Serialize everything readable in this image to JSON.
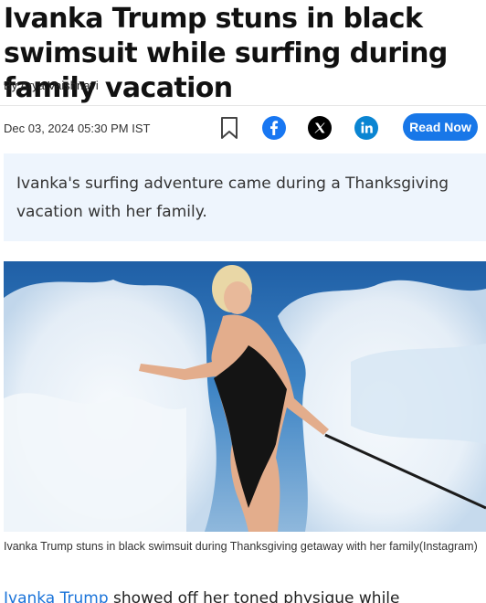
{
  "article": {
    "headline": "Ivanka Trump stuns in black swimsuit while surfing during family vacation",
    "byline": "By Arya Vaishnavi",
    "date": "Dec 03, 2024 05:30 PM IST",
    "read_now_label": "Read Now",
    "summary": "Ivanka's surfing adventure came during a Thanksgiving vacation with her family.",
    "image_caption": "Ivanka Trump stuns in black swimsuit during Thanksgiving getaway with her family(Instagram)",
    "body_link": "Ivanka Trump",
    "body_text": " showed off her toned physique while"
  },
  "share": {
    "bookmark_icon": "bookmark-icon",
    "facebook_icon": "facebook-icon",
    "x_icon": "x-icon",
    "linkedin_icon": "linkedin-icon"
  },
  "colors": {
    "accent": "#1877e8",
    "facebook": "#1877f2",
    "linkedin": "#0a85d2",
    "summary_bg": "#eef5fd",
    "link": "#1a73d9"
  }
}
